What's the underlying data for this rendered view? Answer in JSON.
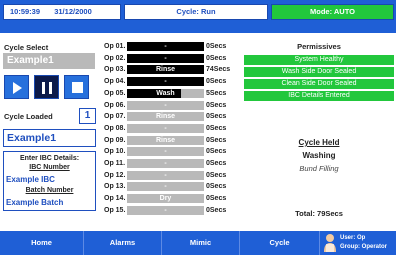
{
  "header": {
    "time": "10:59:39",
    "date": "31/12/2000",
    "cycle_status": "Cycle: Run",
    "mode_status": "Mode: AUTO"
  },
  "left_panel": {
    "cycle_select_label": "Cycle Select",
    "selected_cycle": "Example1",
    "cycle_loaded_label": "Cycle Loaded",
    "cycles_loaded_count": "1",
    "loaded_cycle_name": "Example1",
    "ibc_details_heading": "Enter IBC Details:",
    "ibc_number_label": "IBC Number",
    "ibc_number_value": "Example IBC",
    "batch_number_label": "Batch Number",
    "batch_number_value": "Example Batch"
  },
  "ops": [
    {
      "label": "Op 01.",
      "step": "-",
      "time": "0Secs",
      "state": "active"
    },
    {
      "label": "Op 02.",
      "step": "-",
      "time": "0Secs",
      "state": "active"
    },
    {
      "label": "Op 03.",
      "step": "Rinse",
      "time": "74Secs",
      "state": "active"
    },
    {
      "label": "Op 04.",
      "step": "-",
      "time": "0Secs",
      "state": "active"
    },
    {
      "label": "Op 05.",
      "step": "Wash",
      "time": "5Secs",
      "state": "current"
    },
    {
      "label": "Op 06.",
      "step": "-",
      "time": "0Secs",
      "state": "inactive"
    },
    {
      "label": "Op 07.",
      "step": "Rinse",
      "time": "0Secs",
      "state": "inactive"
    },
    {
      "label": "Op 08.",
      "step": "-",
      "time": "0Secs",
      "state": "inactive"
    },
    {
      "label": "Op 09.",
      "step": "Rinse",
      "time": "0Secs",
      "state": "inactive"
    },
    {
      "label": "Op 10.",
      "step": "-",
      "time": "0Secs",
      "state": "inactive"
    },
    {
      "label": "Op 11.",
      "step": "-",
      "time": "0Secs",
      "state": "inactive"
    },
    {
      "label": "Op 12.",
      "step": "-",
      "time": "0Secs",
      "state": "inactive"
    },
    {
      "label": "Op 13.",
      "step": "-",
      "time": "0Secs",
      "state": "inactive"
    },
    {
      "label": "Op 14.",
      "step": "Dry",
      "time": "0Secs",
      "state": "inactive"
    },
    {
      "label": "Op 15.",
      "step": "-",
      "time": "0Secs",
      "state": "inactive"
    }
  ],
  "current_op_progress": 0.7,
  "permissives": {
    "title": "Permissives",
    "items": [
      "System Healthy",
      "Wash Side Door Sealed",
      "Clean Side Door Sealed",
      "IBC Details Entered"
    ]
  },
  "status": {
    "cycle_state": "Cycle Held",
    "step_name": "Washing",
    "sub_step": "Bund Filling",
    "total_time": "Total: 79Secs"
  },
  "nav": {
    "home": "Home",
    "alarms": "Alarms",
    "mimic": "Mimic",
    "cycle": "Cycle",
    "user": "User: Op",
    "group": "Group: Operator"
  },
  "colors": {
    "header_blue": "#1f5fd6",
    "status_green": "#22c73c",
    "op_active": "#000000",
    "op_inactive": "#b9b9b9"
  },
  "icons": {
    "play": "play-icon",
    "pause": "pause-icon",
    "stop": "stop-icon",
    "user": "user-icon"
  }
}
